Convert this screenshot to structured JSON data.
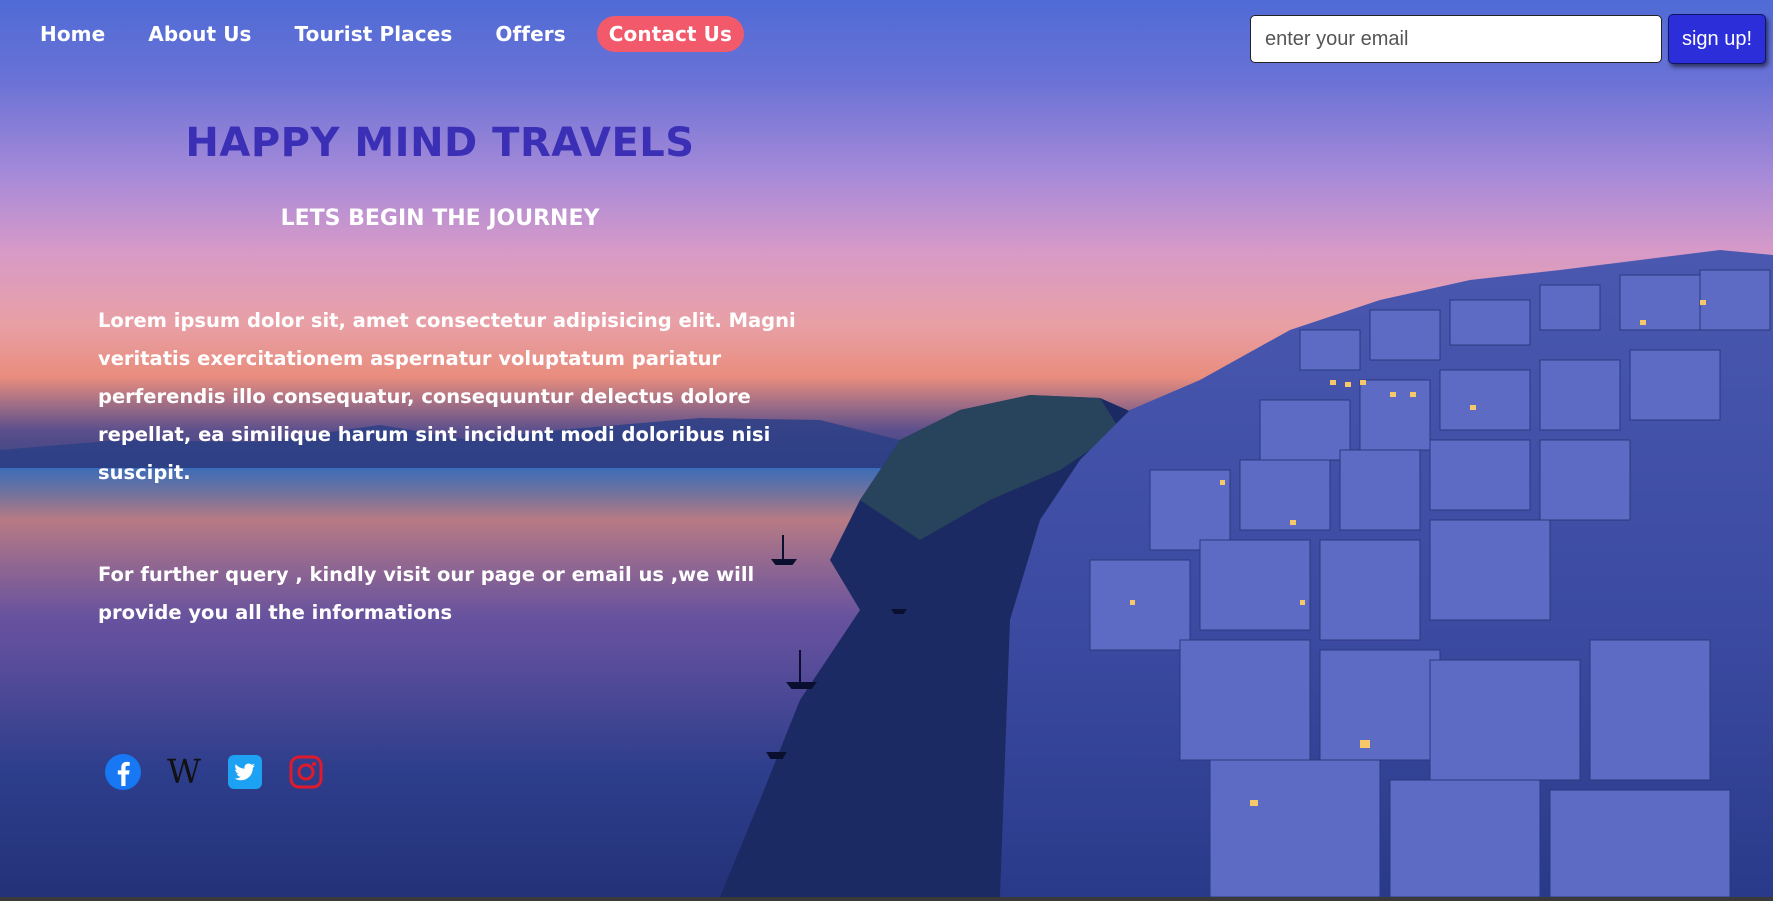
{
  "nav": {
    "items": [
      {
        "label": "Home",
        "active": false
      },
      {
        "label": "About Us",
        "active": false
      },
      {
        "label": "Tourist Places",
        "active": false
      },
      {
        "label": "Offers",
        "active": false
      },
      {
        "label": "Contact Us",
        "active": true
      }
    ],
    "active_color": "#f2596a"
  },
  "signup": {
    "email_placeholder": "enter your email",
    "email_value": "",
    "button_label": "sign up!",
    "button_color": "#2c2fd9"
  },
  "hero": {
    "title": "HAPPY MIND TRAVELS",
    "subtitle": "LETS BEGIN THE JOURNEY",
    "paragraph_1": "Lorem ipsum dolor sit, amet consectetur adipisicing elit. Magni veritatis exercitationem aspernatur voluptatum pariatur perferendis illo consequatur, consequuntur delectus dolore repellat, ea similique harum sint incidunt modi doloribus nisi suscipit.",
    "paragraph_2": "For further query , kindly visit our page or email us ,we will provide you all the informations",
    "title_color": "#3b2fb6"
  },
  "social": {
    "icons": [
      "facebook-icon",
      "wikipedia-icon",
      "twitter-icon",
      "instagram-icon"
    ],
    "colors": {
      "facebook": "#1877f2",
      "wikipedia": "#111111",
      "twitter": "#1da1f2",
      "instagram": "#e01a2b"
    }
  }
}
